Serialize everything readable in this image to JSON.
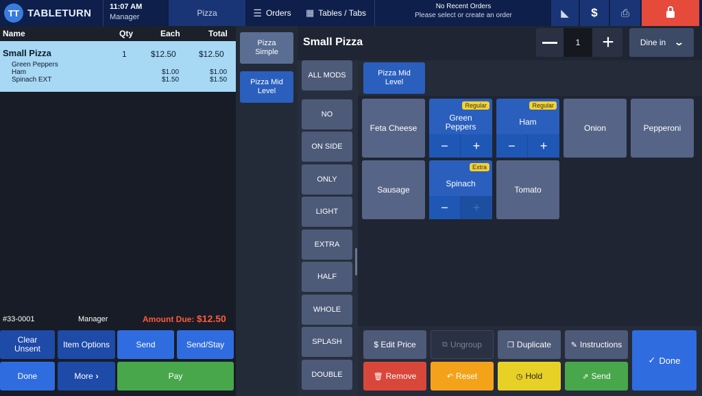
{
  "app": {
    "logo_text": "TABLETURN",
    "time": "11:07 AM",
    "role": "Manager"
  },
  "topbar": {
    "category": "Pizza",
    "orders_label": "Orders",
    "tables_label": "Tables / Tabs",
    "recent_title": "No Recent Orders",
    "recent_subtitle": "Please select or create an order"
  },
  "order": {
    "headers": {
      "name": "Name",
      "qty": "Qty",
      "each": "Each",
      "total": "Total"
    },
    "item": {
      "name": "Small Pizza",
      "qty": "1",
      "each": "$12.50",
      "total": "$12.50"
    },
    "mods": [
      {
        "name": "Green Peppers",
        "each": "",
        "total": ""
      },
      {
        "name": "Ham",
        "each": "$1.00",
        "total": "$1.00"
      },
      {
        "name": "Spinach EXT",
        "each": "$1.50",
        "total": "$1.50"
      }
    ],
    "check_number": "#33-0001",
    "server": "Manager",
    "amount_due_label": "Amount Due:",
    "amount_due": "$12.50"
  },
  "order_buttons": {
    "clear_unsent": "Clear Unsent",
    "item_options": "Item Options",
    "send": "Send",
    "send_stay": "Send/Stay",
    "done": "Done",
    "more": "More",
    "pay": "Pay"
  },
  "menu_items": [
    "Pizza Simple",
    "Pizza Mid Level"
  ],
  "panel": {
    "title": "Small Pizza",
    "quantity": "1",
    "dine_mode": "Dine in",
    "group_tab": "Pizza Mid Level"
  },
  "mod_types": [
    "ALL MODS",
    "NO",
    "ON SIDE",
    "ONLY",
    "LIGHT",
    "EXTRA",
    "HALF",
    "WHOLE",
    "SPLASH",
    "DOUBLE"
  ],
  "modifiers": {
    "feta": "Feta Cheese",
    "green": "Green Peppers",
    "green_badge": "Regular",
    "ham": "Ham",
    "ham_badge": "Regular",
    "onion": "Onion",
    "pepperoni": "Pepperoni",
    "sausage": "Sausage",
    "spinach": "Spinach",
    "spinach_badge": "Extra",
    "tomato": "Tomato"
  },
  "actions": {
    "edit_price": "$ Edit Price",
    "ungroup": "Ungroup",
    "duplicate": "Duplicate",
    "instructions": "Instructions",
    "remove": "Remove",
    "reset": "Reset",
    "hold": "Hold",
    "send": "Send",
    "done": "Done"
  },
  "colors": {
    "topbar": "#0d1f4a",
    "selected_row": "#a7d8f4",
    "primary_blue": "#2a5fbd",
    "pay_green": "#48a74a",
    "remove_red": "#d9473b",
    "reset_orange": "#f5a21b",
    "hold_yellow": "#e8d126",
    "lock_red": "#e64a3b",
    "amount_due_red": "#ff5a3c",
    "badge_yellow": "#f5d130"
  }
}
